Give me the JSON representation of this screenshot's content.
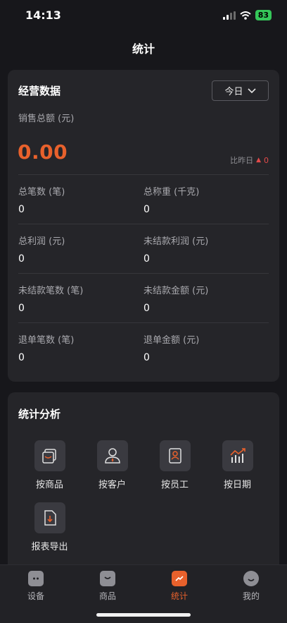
{
  "status_bar": {
    "time": "14:13",
    "battery": "83"
  },
  "nav": {
    "title": "统计"
  },
  "business": {
    "title": "经营数据",
    "period": "今日",
    "sales_label": "销售总额 (元)",
    "sales_value": "0.00",
    "compare_label": "比昨日",
    "compare_value": "0",
    "metrics": [
      {
        "label": "总笔数 (笔)",
        "value": "0"
      },
      {
        "label": "总称重 (千克)",
        "value": "0"
      },
      {
        "label": "总利润 (元)",
        "value": "0"
      },
      {
        "label": "未结款利润 (元)",
        "value": "0"
      },
      {
        "label": "未结款笔数 (笔)",
        "value": "0"
      },
      {
        "label": "未结款金额 (元)",
        "value": "0"
      },
      {
        "label": "退单笔数 (笔)",
        "value": "0"
      },
      {
        "label": "退单金额 (元)",
        "value": "0"
      }
    ]
  },
  "analysis": {
    "title": "统计分析",
    "items": [
      {
        "label": "按商品",
        "icon": "products-icon"
      },
      {
        "label": "按客户",
        "icon": "customer-icon"
      },
      {
        "label": "按员工",
        "icon": "employee-icon"
      },
      {
        "label": "按日期",
        "icon": "date-chart-icon"
      },
      {
        "label": "报表导出",
        "icon": "report-export-icon"
      }
    ]
  },
  "tabs": [
    {
      "label": "设备",
      "icon": "device-icon",
      "active": false
    },
    {
      "label": "商品",
      "icon": "goods-bag-icon",
      "active": false
    },
    {
      "label": "统计",
      "icon": "statistics-icon",
      "active": true
    },
    {
      "label": "我的",
      "icon": "profile-icon",
      "active": false
    }
  ],
  "colors": {
    "accent": "#e8612c",
    "background": "#17171b",
    "card": "#252529",
    "down": "#e24a4a"
  }
}
